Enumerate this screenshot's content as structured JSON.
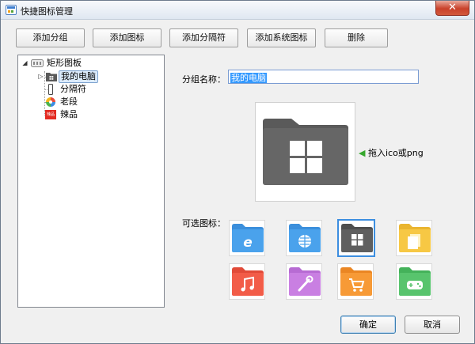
{
  "window": {
    "title": "快捷图标管理",
    "close_label": "✕"
  },
  "toolbar": {
    "buttons": [
      {
        "label": "添加分组"
      },
      {
        "label": "添加图标"
      },
      {
        "label": "添加分隔符"
      },
      {
        "label": "添加系统图标"
      },
      {
        "label": "删除"
      }
    ]
  },
  "tree": {
    "root": {
      "label": "矩形图板",
      "expanded": true
    },
    "items": [
      {
        "label": "我的电脑",
        "icon": "folder-icon",
        "selected": true
      },
      {
        "label": "分隔符",
        "icon": "separator-icon",
        "selected": false
      },
      {
        "label": "老段",
        "icon": "colorful-app-icon",
        "selected": false
      },
      {
        "label": "辣品",
        "icon": "red-app-icon",
        "selected": false,
        "badge": "辣品"
      }
    ]
  },
  "form": {
    "group_name_label": "分组名称：",
    "group_name_value": "我的电脑",
    "preview_hint": "拖入ico或png",
    "available_icons_label": "可选图标："
  },
  "icons": [
    {
      "name": "ie-folder-icon",
      "color": "#4a9fe8",
      "selected": false
    },
    {
      "name": "network-folder-icon",
      "color": "#4a9fe8",
      "selected": false
    },
    {
      "name": "windows-folder-icon",
      "color": "#5a5a5a",
      "selected": true
    },
    {
      "name": "documents-folder-icon",
      "color": "#f5c443",
      "selected": false
    },
    {
      "name": "music-folder-icon",
      "color": "#ef5a48",
      "selected": false
    },
    {
      "name": "tools-folder-icon",
      "color": "#c77ce0",
      "selected": false
    },
    {
      "name": "shop-folder-icon",
      "color": "#f69532",
      "selected": false
    },
    {
      "name": "game-folder-icon",
      "color": "#56c26a",
      "selected": false
    }
  ],
  "footer": {
    "ok_label": "确定",
    "cancel_label": "取消"
  }
}
